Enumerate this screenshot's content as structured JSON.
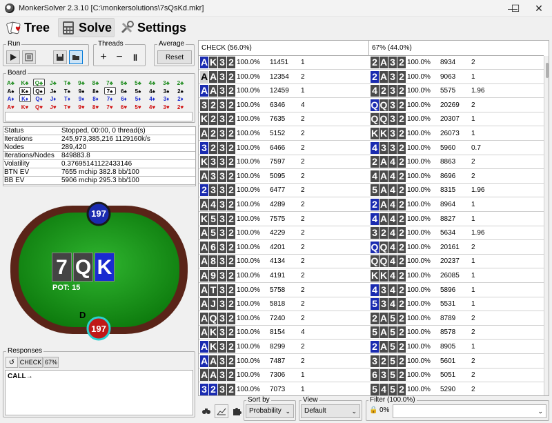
{
  "window": {
    "title": "MonkerSolver 2.3.10 [C:\\monkersolutions\\7sQsKd.mkr]",
    "minimize": "—",
    "maximize": "☐",
    "close": "✕"
  },
  "menu": {
    "tabs": [
      {
        "label": "Tree"
      },
      {
        "label": "Solve"
      },
      {
        "label": "Settings"
      }
    ]
  },
  "toolbar": {
    "run_label": "Run",
    "threads_label": "Threads",
    "average_label": "Average",
    "reset_label": "Reset"
  },
  "board": {
    "label": "Board",
    "rows": [
      {
        "color": "#1b8a1b",
        "cards": [
          "A♣",
          "K♣",
          "Q♣",
          "J♣",
          "T♣",
          "9♣",
          "8♣",
          "7♣",
          "6♣",
          "5♣",
          "4♣",
          "3♣",
          "2♣"
        ]
      },
      {
        "color": "#000000",
        "cards": [
          "A♠",
          "K♠",
          "Q♠",
          "J♠",
          "T♠",
          "9♠",
          "8♠",
          "7♠",
          "6♠",
          "5♠",
          "4♠",
          "3♠",
          "2♠"
        ]
      },
      {
        "color": "#1a2bd0",
        "cards": [
          "A♦",
          "K♦",
          "Q♦",
          "J♦",
          "T♦",
          "9♦",
          "8♦",
          "7♦",
          "6♦",
          "5♦",
          "4♦",
          "3♦",
          "2♦"
        ]
      },
      {
        "color": "#d01010",
        "cards": [
          "A♥",
          "K♥",
          "Q♥",
          "J♥",
          "T♥",
          "9♥",
          "8♥",
          "7♥",
          "6♥",
          "5♥",
          "4♥",
          "3♥",
          "2♥"
        ]
      }
    ]
  },
  "stats": [
    {
      "label": "Status",
      "value": "Stopped, 00:00, 0 thread(s)"
    },
    {
      "label": "Iterations",
      "value": "245,973,385,216  1129160k/s"
    },
    {
      "label": "Nodes",
      "value": "289,420"
    },
    {
      "label": "Iterations/Nodes",
      "value": "849883.8"
    },
    {
      "label": "Volatility",
      "value": "0.376951411224331​46"
    },
    {
      "label": "BTN EV",
      "value": "7655 mchip   382.8 bb/100"
    },
    {
      "label": "BB EV",
      "value": "5906 mchip   295.3 bb/100"
    }
  ],
  "table": {
    "top_seat": "197",
    "bottom_seat": "197",
    "dealer": "D",
    "pot": "POT: 15",
    "board_cards": [
      {
        "rank": "7",
        "suit_color": "#444444"
      },
      {
        "rank": "Q",
        "suit_color": "#444444"
      },
      {
        "rank": "K",
        "suit_color": "#1a2bd0"
      }
    ]
  },
  "responses": {
    "label": "Responses",
    "action": "CHECK",
    "pct": "67%",
    "text": "CALL→"
  },
  "columns": {
    "left_header": "CHECK (56.0%)",
    "right_header": "67% (44.0%)"
  },
  "left_rows": [
    {
      "cards": [
        [
          "A",
          "b"
        ],
        [
          "K",
          "k"
        ],
        [
          "3",
          "k"
        ],
        [
          "2",
          "k"
        ]
      ],
      "pct": "100.0%",
      "n": "11451",
      "v": "1"
    },
    {
      "cards": [
        [
          "A",
          "g"
        ],
        [
          "A",
          "k"
        ],
        [
          "3",
          "k"
        ],
        [
          "2",
          "k"
        ]
      ],
      "pct": "100.0%",
      "n": "12354",
      "v": "2"
    },
    {
      "cards": [
        [
          "A",
          "b"
        ],
        [
          "A",
          "k"
        ],
        [
          "3",
          "k"
        ],
        [
          "2",
          "k"
        ]
      ],
      "pct": "100.0%",
      "n": "12459",
      "v": "1"
    },
    {
      "cards": [
        [
          "3",
          "k"
        ],
        [
          "2",
          "k"
        ],
        [
          "3",
          "k"
        ],
        [
          "2",
          "k"
        ]
      ],
      "pct": "100.0%",
      "n": "6346",
      "v": "4"
    },
    {
      "cards": [
        [
          "K",
          "k"
        ],
        [
          "2",
          "k"
        ],
        [
          "3",
          "k"
        ],
        [
          "2",
          "k"
        ]
      ],
      "pct": "100.0%",
      "n": "7635",
      "v": "2"
    },
    {
      "cards": [
        [
          "A",
          "k"
        ],
        [
          "2",
          "k"
        ],
        [
          "3",
          "k"
        ],
        [
          "2",
          "k"
        ]
      ],
      "pct": "100.0%",
      "n": "5152",
      "v": "2"
    },
    {
      "cards": [
        [
          "3",
          "b"
        ],
        [
          "2",
          "k"
        ],
        [
          "3",
          "k"
        ],
        [
          "2",
          "k"
        ]
      ],
      "pct": "100.0%",
      "n": "6466",
      "v": "2"
    },
    {
      "cards": [
        [
          "K",
          "k"
        ],
        [
          "3",
          "k"
        ],
        [
          "3",
          "k"
        ],
        [
          "2",
          "k"
        ]
      ],
      "pct": "100.0%",
      "n": "7597",
      "v": "2"
    },
    {
      "cards": [
        [
          "A",
          "k"
        ],
        [
          "3",
          "k"
        ],
        [
          "3",
          "k"
        ],
        [
          "2",
          "k"
        ]
      ],
      "pct": "100.0%",
      "n": "5095",
      "v": "2"
    },
    {
      "cards": [
        [
          "2",
          "b"
        ],
        [
          "3",
          "k"
        ],
        [
          "3",
          "k"
        ],
        [
          "2",
          "k"
        ]
      ],
      "pct": "100.0%",
      "n": "6477",
      "v": "2"
    },
    {
      "cards": [
        [
          "A",
          "k"
        ],
        [
          "4",
          "k"
        ],
        [
          "3",
          "k"
        ],
        [
          "2",
          "k"
        ]
      ],
      "pct": "100.0%",
      "n": "4289",
      "v": "2"
    },
    {
      "cards": [
        [
          "K",
          "k"
        ],
        [
          "5",
          "k"
        ],
        [
          "3",
          "k"
        ],
        [
          "2",
          "k"
        ]
      ],
      "pct": "100.0%",
      "n": "7575",
      "v": "2"
    },
    {
      "cards": [
        [
          "A",
          "k"
        ],
        [
          "5",
          "k"
        ],
        [
          "3",
          "k"
        ],
        [
          "2",
          "k"
        ]
      ],
      "pct": "100.0%",
      "n": "4229",
      "v": "2"
    },
    {
      "cards": [
        [
          "A",
          "k"
        ],
        [
          "6",
          "k"
        ],
        [
          "3",
          "k"
        ],
        [
          "2",
          "k"
        ]
      ],
      "pct": "100.0%",
      "n": "4201",
      "v": "2"
    },
    {
      "cards": [
        [
          "A",
          "k"
        ],
        [
          "8",
          "k"
        ],
        [
          "3",
          "k"
        ],
        [
          "2",
          "k"
        ]
      ],
      "pct": "100.0%",
      "n": "4134",
      "v": "2"
    },
    {
      "cards": [
        [
          "A",
          "k"
        ],
        [
          "9",
          "k"
        ],
        [
          "3",
          "k"
        ],
        [
          "2",
          "k"
        ]
      ],
      "pct": "100.0%",
      "n": "4191",
      "v": "2"
    },
    {
      "cards": [
        [
          "A",
          "k"
        ],
        [
          "T",
          "k"
        ],
        [
          "3",
          "k"
        ],
        [
          "2",
          "k"
        ]
      ],
      "pct": "100.0%",
      "n": "5758",
      "v": "2"
    },
    {
      "cards": [
        [
          "A",
          "k"
        ],
        [
          "J",
          "k"
        ],
        [
          "3",
          "k"
        ],
        [
          "2",
          "k"
        ]
      ],
      "pct": "100.0%",
      "n": "5818",
      "v": "2"
    },
    {
      "cards": [
        [
          "A",
          "k"
        ],
        [
          "Q",
          "k"
        ],
        [
          "3",
          "k"
        ],
        [
          "2",
          "k"
        ]
      ],
      "pct": "100.0%",
      "n": "7240",
      "v": "2"
    },
    {
      "cards": [
        [
          "A",
          "k"
        ],
        [
          "K",
          "k"
        ],
        [
          "3",
          "k"
        ],
        [
          "2",
          "k"
        ]
      ],
      "pct": "100.0%",
      "n": "8154",
      "v": "4"
    },
    {
      "cards": [
        [
          "A",
          "b"
        ],
        [
          "K",
          "k"
        ],
        [
          "3",
          "k"
        ],
        [
          "2",
          "k"
        ]
      ],
      "pct": "100.0%",
      "n": "8299",
      "v": "2"
    },
    {
      "cards": [
        [
          "A",
          "b"
        ],
        [
          "A",
          "k"
        ],
        [
          "3",
          "k"
        ],
        [
          "2",
          "k"
        ]
      ],
      "pct": "100.0%",
      "n": "7487",
      "v": "2"
    },
    {
      "cards": [
        [
          "A",
          "k"
        ],
        [
          "A",
          "k"
        ],
        [
          "3",
          "k"
        ],
        [
          "2",
          "k"
        ]
      ],
      "pct": "100.0%",
      "n": "7306",
      "v": "1"
    },
    {
      "cards": [
        [
          "3",
          "b"
        ],
        [
          "2",
          "b"
        ],
        [
          "3",
          "k"
        ],
        [
          "2",
          "k"
        ]
      ],
      "pct": "100.0%",
      "n": "7073",
      "v": "1"
    }
  ],
  "right_rows": [
    {
      "cards": [
        [
          "2",
          "k"
        ],
        [
          "A",
          "k"
        ],
        [
          "3",
          "k"
        ],
        [
          "2",
          "k"
        ]
      ],
      "pct": "100.0%",
      "n": "8934",
      "v": "2"
    },
    {
      "cards": [
        [
          "2",
          "b"
        ],
        [
          "A",
          "k"
        ],
        [
          "3",
          "k"
        ],
        [
          "2",
          "k"
        ]
      ],
      "pct": "100.0%",
      "n": "9063",
      "v": "1"
    },
    {
      "cards": [
        [
          "4",
          "k"
        ],
        [
          "2",
          "k"
        ],
        [
          "3",
          "k"
        ],
        [
          "2",
          "k"
        ]
      ],
      "pct": "100.0%",
      "n": "5575",
      "v": "1.96"
    },
    {
      "cards": [
        [
          "Q",
          "b"
        ],
        [
          "Q",
          "k"
        ],
        [
          "3",
          "k"
        ],
        [
          "2",
          "k"
        ]
      ],
      "pct": "100.0%",
      "n": "20269",
      "v": "2"
    },
    {
      "cards": [
        [
          "Q",
          "k"
        ],
        [
          "Q",
          "k"
        ],
        [
          "3",
          "k"
        ],
        [
          "2",
          "k"
        ]
      ],
      "pct": "100.0%",
      "n": "20307",
      "v": "1"
    },
    {
      "cards": [
        [
          "K",
          "k"
        ],
        [
          "K",
          "k"
        ],
        [
          "3",
          "k"
        ],
        [
          "2",
          "k"
        ]
      ],
      "pct": "100.0%",
      "n": "26073",
      "v": "1"
    },
    {
      "cards": [
        [
          "4",
          "b"
        ],
        [
          "3",
          "k"
        ],
        [
          "3",
          "k"
        ],
        [
          "2",
          "k"
        ]
      ],
      "pct": "100.0%",
      "n": "5960",
      "v": "0.7"
    },
    {
      "cards": [
        [
          "2",
          "k"
        ],
        [
          "A",
          "k"
        ],
        [
          "4",
          "k"
        ],
        [
          "2",
          "k"
        ]
      ],
      "pct": "100.0%",
      "n": "8863",
      "v": "2"
    },
    {
      "cards": [
        [
          "4",
          "k"
        ],
        [
          "A",
          "k"
        ],
        [
          "4",
          "k"
        ],
        [
          "2",
          "k"
        ]
      ],
      "pct": "100.0%",
      "n": "8696",
      "v": "2"
    },
    {
      "cards": [
        [
          "5",
          "k"
        ],
        [
          "A",
          "k"
        ],
        [
          "4",
          "k"
        ],
        [
          "2",
          "k"
        ]
      ],
      "pct": "100.0%",
      "n": "8315",
      "v": "1.96"
    },
    {
      "cards": [
        [
          "2",
          "b"
        ],
        [
          "A",
          "k"
        ],
        [
          "4",
          "k"
        ],
        [
          "2",
          "k"
        ]
      ],
      "pct": "100.0%",
      "n": "8964",
      "v": "1"
    },
    {
      "cards": [
        [
          "4",
          "b"
        ],
        [
          "A",
          "k"
        ],
        [
          "4",
          "k"
        ],
        [
          "2",
          "k"
        ]
      ],
      "pct": "100.0%",
      "n": "8827",
      "v": "1"
    },
    {
      "cards": [
        [
          "3",
          "k"
        ],
        [
          "2",
          "k"
        ],
        [
          "4",
          "k"
        ],
        [
          "2",
          "k"
        ]
      ],
      "pct": "100.0%",
      "n": "5634",
      "v": "1.96"
    },
    {
      "cards": [
        [
          "Q",
          "b"
        ],
        [
          "Q",
          "k"
        ],
        [
          "4",
          "k"
        ],
        [
          "2",
          "k"
        ]
      ],
      "pct": "100.0%",
      "n": "20161",
      "v": "2"
    },
    {
      "cards": [
        [
          "Q",
          "k"
        ],
        [
          "Q",
          "k"
        ],
        [
          "4",
          "k"
        ],
        [
          "2",
          "k"
        ]
      ],
      "pct": "100.0%",
      "n": "20237",
      "v": "1"
    },
    {
      "cards": [
        [
          "K",
          "k"
        ],
        [
          "K",
          "k"
        ],
        [
          "4",
          "k"
        ],
        [
          "2",
          "k"
        ]
      ],
      "pct": "100.0%",
      "n": "26085",
      "v": "1"
    },
    {
      "cards": [
        [
          "4",
          "b"
        ],
        [
          "3",
          "k"
        ],
        [
          "4",
          "k"
        ],
        [
          "2",
          "k"
        ]
      ],
      "pct": "100.0%",
      "n": "5896",
      "v": "1"
    },
    {
      "cards": [
        [
          "5",
          "b"
        ],
        [
          "3",
          "k"
        ],
        [
          "4",
          "k"
        ],
        [
          "2",
          "k"
        ]
      ],
      "pct": "100.0%",
      "n": "5531",
      "v": "1"
    },
    {
      "cards": [
        [
          "2",
          "k"
        ],
        [
          "A",
          "k"
        ],
        [
          "5",
          "k"
        ],
        [
          "2",
          "k"
        ]
      ],
      "pct": "100.0%",
      "n": "8789",
      "v": "2"
    },
    {
      "cards": [
        [
          "5",
          "k"
        ],
        [
          "A",
          "k"
        ],
        [
          "5",
          "k"
        ],
        [
          "2",
          "k"
        ]
      ],
      "pct": "100.0%",
      "n": "8578",
      "v": "2"
    },
    {
      "cards": [
        [
          "2",
          "b"
        ],
        [
          "A",
          "k"
        ],
        [
          "5",
          "k"
        ],
        [
          "2",
          "k"
        ]
      ],
      "pct": "100.0%",
      "n": "8905",
      "v": "1"
    },
    {
      "cards": [
        [
          "3",
          "k"
        ],
        [
          "2",
          "k"
        ],
        [
          "5",
          "k"
        ],
        [
          "2",
          "k"
        ]
      ],
      "pct": "100.0%",
      "n": "5601",
      "v": "2"
    },
    {
      "cards": [
        [
          "6",
          "k"
        ],
        [
          "3",
          "k"
        ],
        [
          "5",
          "k"
        ],
        [
          "2",
          "k"
        ]
      ],
      "pct": "100.0%",
      "n": "5051",
      "v": "2"
    },
    {
      "cards": [
        [
          "5",
          "k"
        ],
        [
          "4",
          "k"
        ],
        [
          "5",
          "k"
        ],
        [
          "2",
          "k"
        ]
      ],
      "pct": "100.0%",
      "n": "5290",
      "v": "2"
    }
  ],
  "bottom": {
    "sort_label": "Sort by",
    "sort_value": "Probability",
    "view_label": "View",
    "view_value": "Default",
    "filter_label": "Filter (100.0%)",
    "filter_pct": "0%",
    "filter_placeholder": ""
  }
}
